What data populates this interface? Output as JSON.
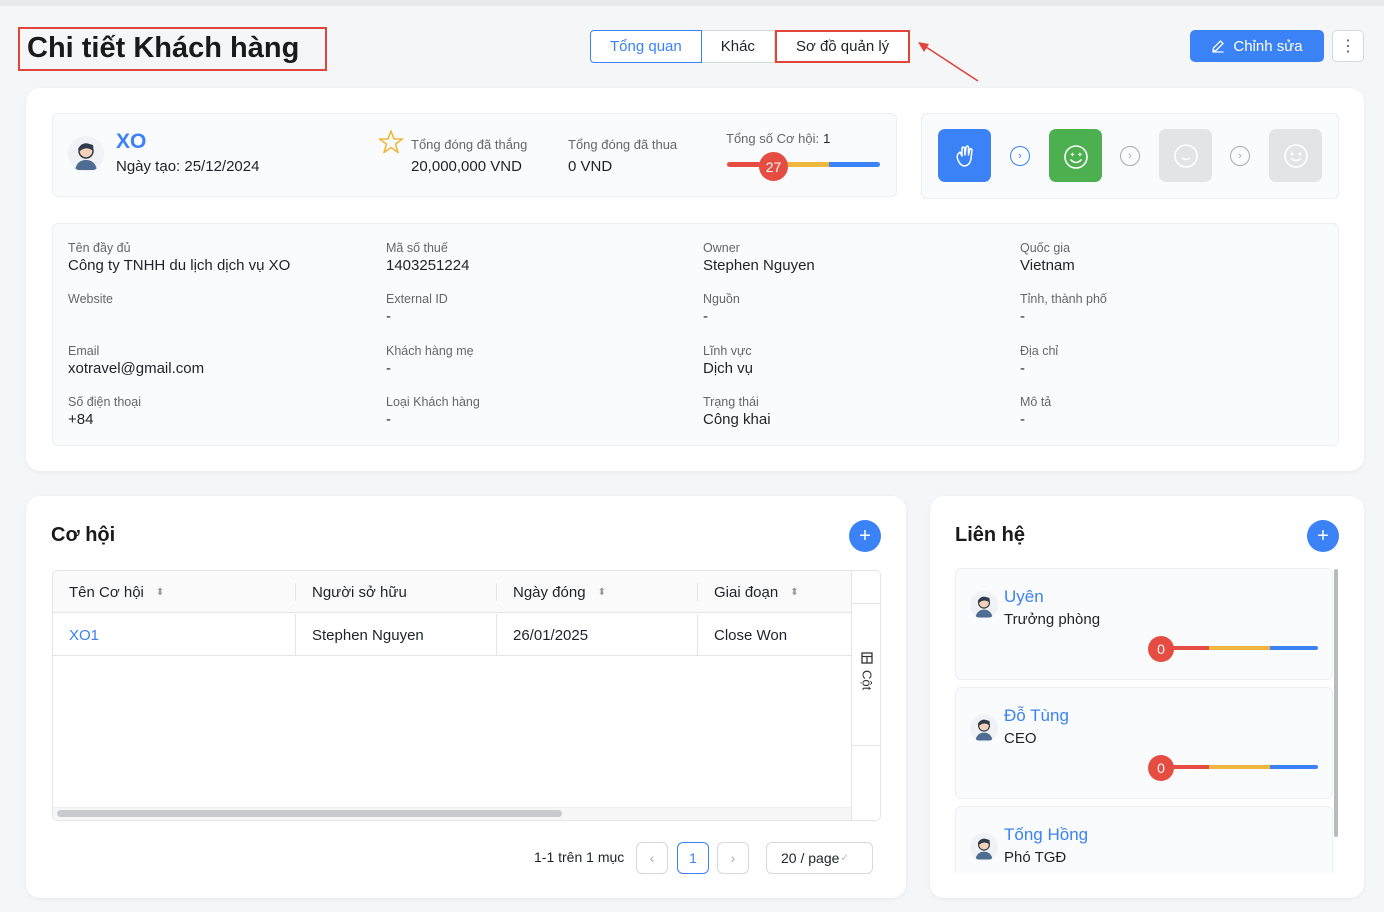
{
  "header": {
    "title": "Chi tiết Khách hàng",
    "tabs": [
      "Tổng quan",
      "Khác",
      "Sơ đồ quản lý"
    ],
    "edit_label": "Chỉnh sửa",
    "more_icon": "⋮"
  },
  "customer": {
    "name": "XO",
    "created": "Ngày tạo: 25/12/2024",
    "won_label": "Tổng đóng đã thắng",
    "won_value": "20,000,000 VND",
    "lost_label": "Tổng đóng đã thua",
    "lost_value": "0 VND",
    "opp_label": "Tổng số Cơ hội:",
    "opp_count": "1",
    "score": "27"
  },
  "fields": [
    {
      "label": "Tên đầy đủ",
      "value": "Công ty TNHH du lịch dịch vụ XO"
    },
    {
      "label": "Mã số thuế",
      "value": "1403251224"
    },
    {
      "label": "Owner",
      "value": "Stephen Nguyen"
    },
    {
      "label": "Quốc gia",
      "value": "Vietnam"
    },
    {
      "label": "Website",
      "value": ""
    },
    {
      "label": "External ID",
      "value": "-"
    },
    {
      "label": "Nguồn",
      "value": "-"
    },
    {
      "label": "Tỉnh, thành phố",
      "value": "-"
    },
    {
      "label": "Email",
      "value": "xotravel@gmail.com"
    },
    {
      "label": "Khách hàng mẹ",
      "value": "-"
    },
    {
      "label": "Lĩnh vực",
      "value": "Dịch vụ"
    },
    {
      "label": "Địa chỉ",
      "value": "-"
    },
    {
      "label": "Số điện thoại",
      "value": "+84"
    },
    {
      "label": "Loại Khách hàng",
      "value": "-"
    },
    {
      "label": "Trạng thái",
      "value": "Công khai"
    },
    {
      "label": "Mô tả",
      "value": "-"
    }
  ],
  "opportunities": {
    "title": "Cơ hội",
    "columns": [
      "Tên Cơ hội",
      "Người sở hữu",
      "Ngày đóng",
      "Giai đoạn"
    ],
    "rows": [
      {
        "name": "XO1",
        "owner": "Stephen Nguyen",
        "close_date": "26/01/2025",
        "stage": "Close Won"
      }
    ],
    "columns_toggle": "Cột",
    "pager_text": "1-1 trên 1 mục",
    "current_page": "1",
    "page_size": "20 / page"
  },
  "contacts": {
    "title": "Liên hệ",
    "items": [
      {
        "name": "Uyên",
        "role": "Trưởng phòng",
        "score": "0"
      },
      {
        "name": "Đỗ Tùng",
        "role": "CEO",
        "score": "0"
      },
      {
        "name": "Tống Hồng",
        "role": "Phó TGĐ",
        "score": "0"
      }
    ]
  },
  "colors": {
    "accent": "#3b82f6",
    "danger": "#e54d42",
    "warning": "#f0b73e",
    "success": "#4caf50",
    "highlight": "#e0443a"
  }
}
